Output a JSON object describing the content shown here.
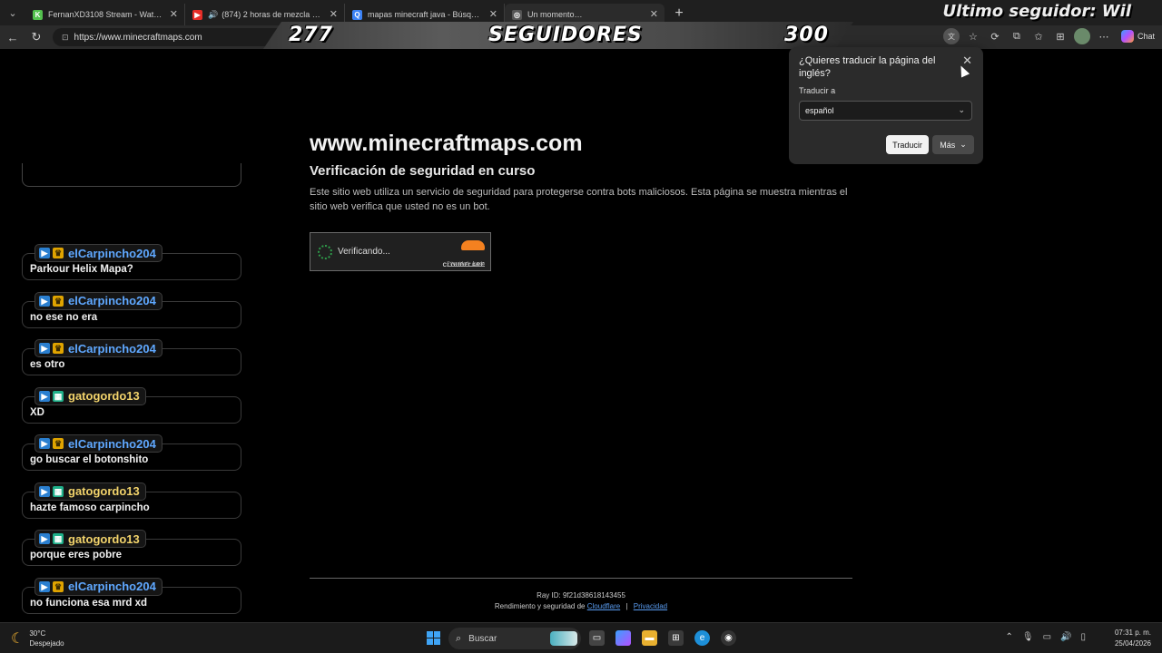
{
  "tabs": [
    {
      "label": "FernanXD3108 Stream - Watch Li...",
      "favicon": "kick-icon",
      "color": "#53c14e",
      "glyph": "K"
    },
    {
      "label": "(874) 2 horas de mezcla de m...",
      "favicon": "youtube-icon",
      "color": "#e52d27",
      "glyph": "▶",
      "audio": "🔊"
    },
    {
      "label": "mapas minecraft java - Búsqueda",
      "favicon": "bing-search-icon",
      "color": "#3b82f6",
      "glyph": "Q"
    },
    {
      "label": "Un momento…",
      "favicon": "globe-icon",
      "color": "#555",
      "glyph": "◎"
    }
  ],
  "address": {
    "url": "https://www.minecraftmaps.com"
  },
  "toolbar": {
    "chat_label": "Chat"
  },
  "overlay": {
    "followers_current": "277",
    "followers_label": "SEGUIDORES",
    "followers_goal": "300",
    "last_follower": "Ultimo seguidor: Wil"
  },
  "page": {
    "domain": "www.minecraftmaps.com",
    "heading": "Verificación de seguridad en curso",
    "description": "Este sitio web utiliza un servicio de seguridad para protegerse contra bots maliciosos. Esta página se muestra mientras el sitio web verifica que usted no es un bot.",
    "captcha": {
      "status": "Verificando...",
      "brand": "CLOUDFLARE",
      "links": "Privacidad • Ayuda"
    },
    "footer": {
      "ray_id": "Ray ID: 9f21d38618143455",
      "perf_prefix": "Rendimiento y seguridad de",
      "cloudflare_link": "Cloudflare",
      "separator": "|",
      "privacy_link": "Privacidad"
    }
  },
  "translate_popup": {
    "question": "¿Quieres traducir la página del inglés?",
    "translate_to_label": "Traducir a",
    "language": "español",
    "translate_button": "Traducir",
    "more_button": "Más"
  },
  "chat": [
    {
      "user": "elCarpincho204",
      "color": "#5fa8ff",
      "badges": [
        "b1",
        "b2"
      ],
      "message": "Parkour Helix Mapa?"
    },
    {
      "user": "elCarpincho204",
      "color": "#5fa8ff",
      "badges": [
        "b1",
        "b2"
      ],
      "message": "no ese no era"
    },
    {
      "user": "elCarpincho204",
      "color": "#5fa8ff",
      "badges": [
        "b1",
        "b2"
      ],
      "message": "es otro"
    },
    {
      "user": "gatogordo13",
      "color": "#f2d36b",
      "badges": [
        "b1",
        "b3"
      ],
      "message": "XD"
    },
    {
      "user": "elCarpincho204",
      "color": "#5fa8ff",
      "badges": [
        "b1",
        "b2"
      ],
      "message": "go buscar el botonshito"
    },
    {
      "user": "gatogordo13",
      "color": "#f2d36b",
      "badges": [
        "b1",
        "b3"
      ],
      "message": "hazte famoso carpincho"
    },
    {
      "user": "gatogordo13",
      "color": "#f2d36b",
      "badges": [
        "b1",
        "b3"
      ],
      "message": "porque eres pobre"
    },
    {
      "user": "elCarpincho204",
      "color": "#5fa8ff",
      "badges": [
        "b1",
        "b2"
      ],
      "message": "no funciona esa mrd xd"
    }
  ],
  "taskbar": {
    "weather_temp": "30°C",
    "weather_desc": "Despejado",
    "search_label": "Buscar",
    "time": "07:31 p. m.",
    "date": "25/04/2026"
  }
}
